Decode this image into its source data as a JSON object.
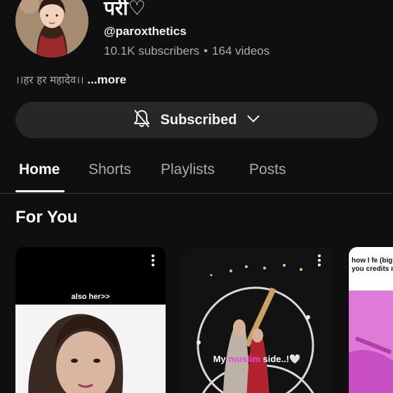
{
  "channel": {
    "name": "परी♡",
    "handle": "@paroxthetics",
    "subscribers": "10.1K subscribers",
    "separator": "•",
    "videos": "164 videos",
    "description": "।।हर हर महादेव।।",
    "more_label": "...more"
  },
  "subscribe_button": {
    "label": "Subscribed",
    "icon": "bell-off-icon",
    "dropdown_icon": "chevron-down-icon"
  },
  "tabs": [
    {
      "label": "Home",
      "active": true
    },
    {
      "label": "Shorts",
      "active": false
    },
    {
      "label": "Playlists",
      "active": false
    },
    {
      "label": "Posts",
      "active": false
    }
  ],
  "section": {
    "title": "For You"
  },
  "shorts": [
    {
      "caption": "also her>>"
    },
    {
      "caption_parts": [
        "My ",
        "muslim",
        " side..!🤍"
      ]
    },
    {
      "caption": "how I fe (big you credits n"
    }
  ],
  "colors": {
    "background": "#0f0f0f",
    "button_bg": "#272727",
    "secondary_text": "#aaaaaa",
    "highlight_pink": "#e34bd1"
  }
}
